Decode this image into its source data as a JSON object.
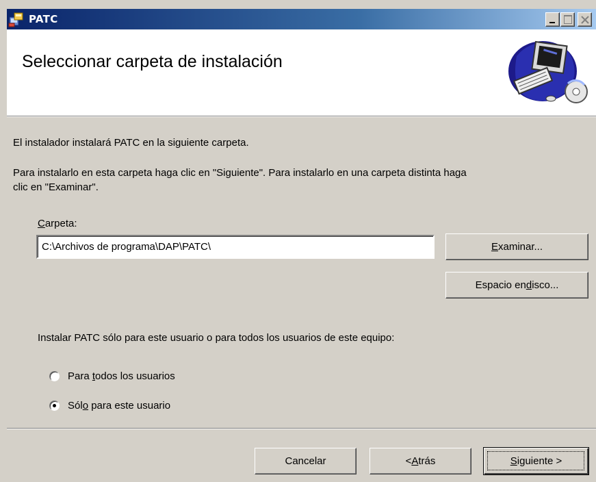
{
  "window": {
    "title": "PATC",
    "controls": [
      "minimize-icon",
      "maximize-icon",
      "close-icon"
    ]
  },
  "banner": {
    "title": "Seleccionar carpeta de instalación"
  },
  "body": {
    "intro": "El instalador instalará PATC en la siguiente carpeta.",
    "instructions_line1": "Para instalarlo en esta carpeta haga clic en \"Siguiente\". Para instalarlo en una carpeta distinta haga",
    "instructions_line2": "clic en \"Examinar\".",
    "folder_label_accel": "C",
    "folder_label_rest": "arpeta:",
    "folder_value": "C:\\Archivos de programa\\DAP\\PATC\\",
    "browse_accel": "E",
    "browse_rest": "xaminar...",
    "disk_pre": "Espacio en ",
    "disk_accel": "d",
    "disk_rest": "isco...",
    "scope_prompt": "Instalar PATC sólo para este usuario o para todos los usuarios de este equipo:",
    "radio_all_pre": "Para ",
    "radio_all_accel": "t",
    "radio_all_rest": "odos los usuarios",
    "radio_me_pre": "Sól",
    "radio_me_accel": "o",
    "radio_me_rest": " para este usuario",
    "selected_option": "Sólo para este usuario"
  },
  "footer": {
    "cancel": "Cancelar",
    "back_pre": "< ",
    "back_accel": "A",
    "back_rest": "trás",
    "next_accel": "S",
    "next_rest": "iguiente >"
  },
  "colors": {
    "titlebar_start": "#0a246a",
    "titlebar_end": "#a6caf0",
    "face": "#d4d0c8"
  }
}
